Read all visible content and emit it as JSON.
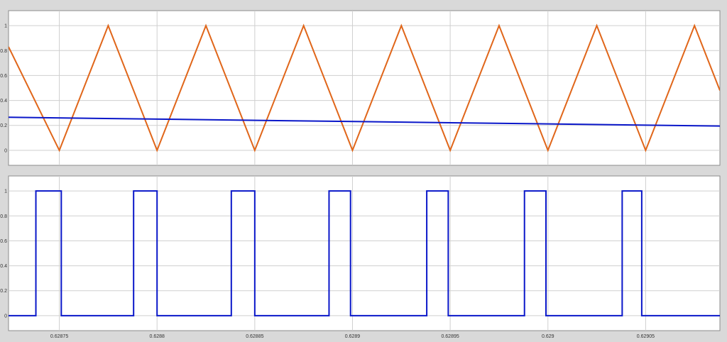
{
  "window": {
    "background": "#d9d9d9"
  },
  "chart_data": [
    {
      "type": "line",
      "title": "",
      "xlabel": "",
      "ylabel": "",
      "xlim": [
        0.628724,
        0.629088
      ],
      "ylim": [
        -0.12,
        1.12
      ],
      "grid": true,
      "legend": "none",
      "yticks": [
        0,
        0.2,
        0.4,
        0.6,
        0.8,
        1
      ],
      "ytick_labels": [
        "0",
        "0.2",
        "0.4",
        "0.6",
        "0.8",
        "1"
      ],
      "series": [
        {
          "color": "#e0661a",
          "x": [
            0.628724,
            0.62875,
            0.628775,
            0.6288,
            0.628825,
            0.62885,
            0.628875,
            0.6289,
            0.628925,
            0.62895,
            0.628975,
            0.629,
            0.629025,
            0.62905,
            0.629075,
            0.629088
          ],
          "y": [
            0.83,
            0,
            1,
            0,
            1,
            0,
            1,
            0,
            1,
            0,
            1,
            0,
            1,
            0,
            1,
            0.48
          ]
        },
        {
          "color": "#0a17c9",
          "x": [
            0.628724,
            0.629088
          ],
          "y": [
            0.265,
            0.195
          ]
        }
      ]
    },
    {
      "type": "line",
      "title": "",
      "xlabel": "",
      "ylabel": "",
      "xlim": [
        0.628724,
        0.629088
      ],
      "ylim": [
        -0.12,
        1.12
      ],
      "grid": true,
      "legend": "none",
      "yticks": [
        0,
        0.2,
        0.4,
        0.6,
        0.8,
        1
      ],
      "ytick_labels": [
        "0",
        "0.2",
        "0.4",
        "0.6",
        "0.8",
        "1"
      ],
      "xticks": [
        0.62875,
        0.6288,
        0.62885,
        0.6289,
        0.62895,
        0.629,
        0.62905
      ],
      "xtick_labels": [
        "0.62875",
        "0.6288",
        "0.62885",
        "0.6289",
        "0.62895",
        "0.629",
        "0.62905"
      ],
      "series": [
        {
          "color": "#0a17c9",
          "step": true,
          "x": [
            0.628724,
            0.628738,
            0.628738,
            0.628751,
            0.628751,
            0.628788,
            0.628788,
            0.6288,
            0.6288,
            0.628838,
            0.628838,
            0.62885,
            0.62885,
            0.628888,
            0.628888,
            0.628899,
            0.628899,
            0.628938,
            0.628938,
            0.628949,
            0.628949,
            0.628988,
            0.628988,
            0.628999,
            0.628999,
            0.629038,
            0.629038,
            0.629048,
            0.629048,
            0.629088
          ],
          "y": [
            0,
            0,
            1,
            1,
            0,
            0,
            1,
            1,
            0,
            0,
            1,
            1,
            0,
            0,
            1,
            1,
            0,
            0,
            1,
            1,
            0,
            0,
            1,
            1,
            0,
            0,
            1,
            1,
            0,
            0
          ]
        }
      ]
    }
  ]
}
